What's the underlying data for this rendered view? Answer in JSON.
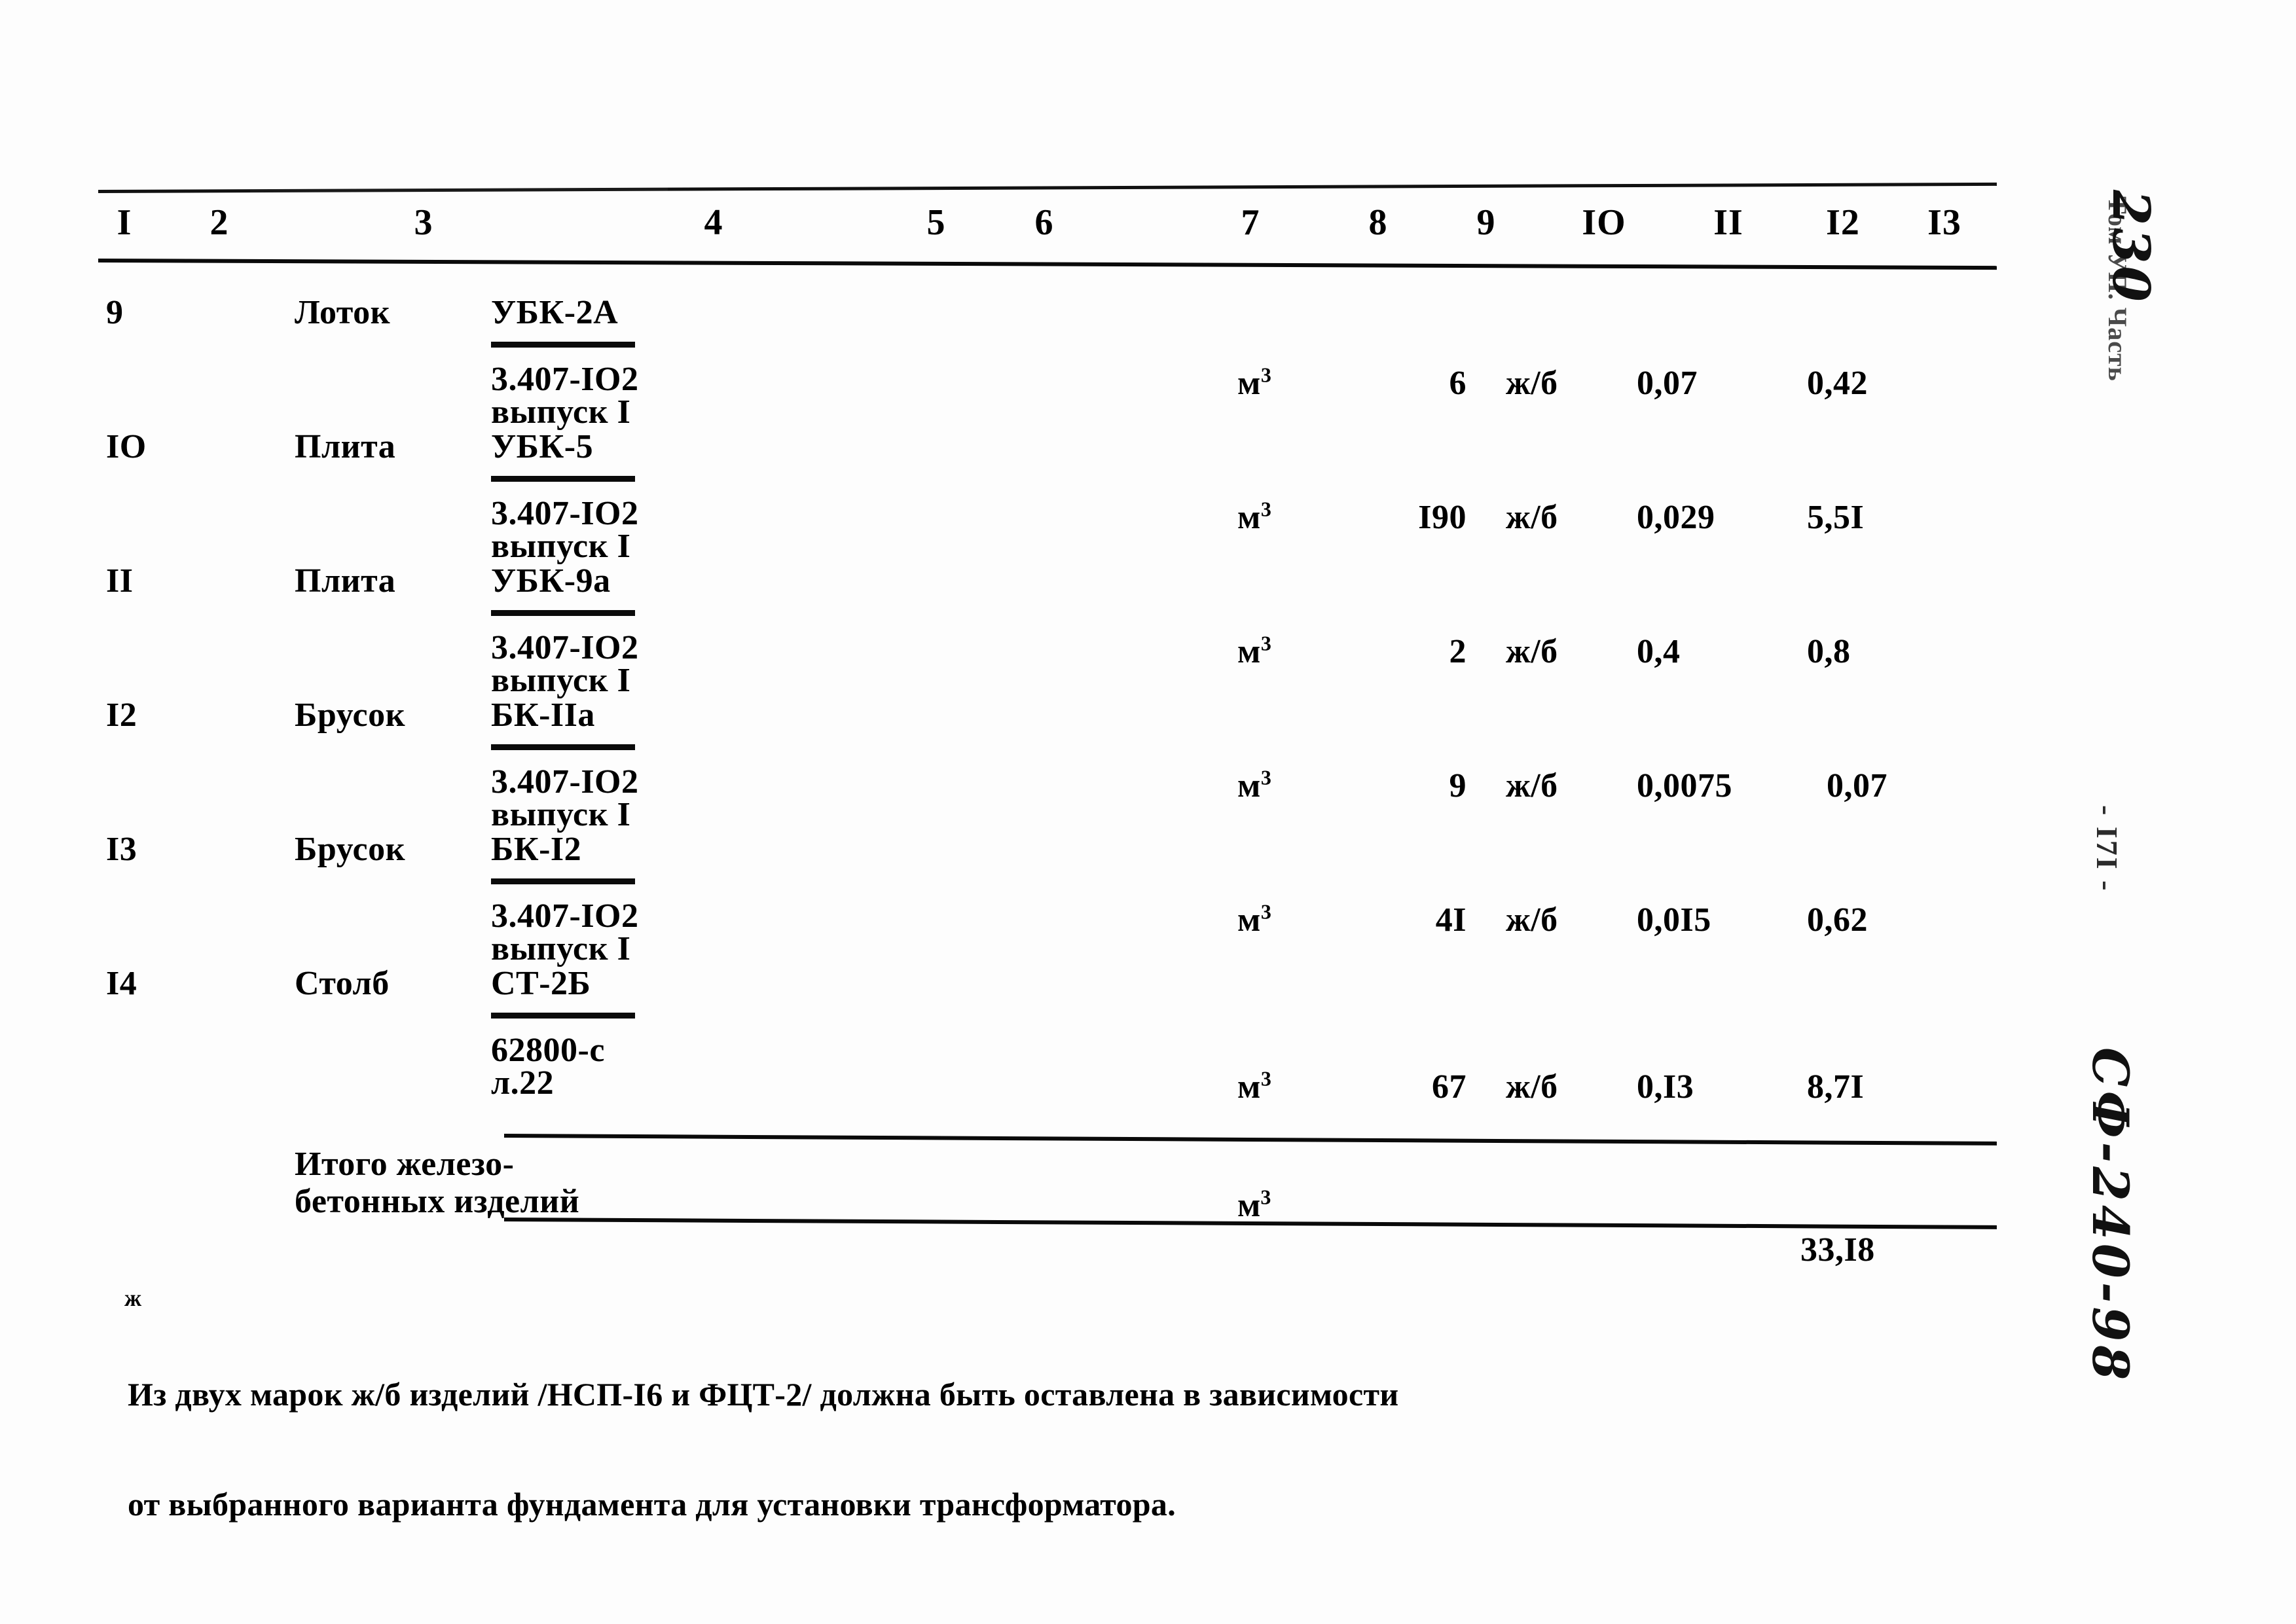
{
  "document": {
    "type": "scanned-specification-table",
    "page_label": "- I7I -",
    "margin_volume": "Том УП. Часть",
    "margin_hand_number": "230",
    "margin_archive_code": "СФ-240-98"
  },
  "table": {
    "column_headers": [
      "I",
      "2",
      "3",
      "4",
      "5",
      "6",
      "7",
      "8",
      "9",
      "IO",
      "II",
      "I2",
      "I3"
    ],
    "rows": [
      {
        "num": "9",
        "name": "Лоток",
        "mark": "УБК-2А",
        "spec_line1": "3.407-IO2",
        "spec_line2": "выпуск I",
        "unit": "м",
        "unit_sup": "3",
        "qty": "6",
        "material": "ж/б",
        "unit_weight": "0,07",
        "total_weight": "0,42"
      },
      {
        "num": "IO",
        "name": "Плита",
        "mark": "УБК-5",
        "spec_line1": "3.407-IO2",
        "spec_line2": "выпуск I",
        "unit": "м",
        "unit_sup": "3",
        "qty": "I90",
        "material": "ж/б",
        "unit_weight": "0,029",
        "total_weight": "5,5I"
      },
      {
        "num": "II",
        "name": "Плита",
        "mark": "УБК-9а",
        "spec_line1": "3.407-IO2",
        "spec_line2": "выпуск I",
        "unit": "м",
        "unit_sup": "3",
        "qty": "2",
        "material": "ж/б",
        "unit_weight": "0,4",
        "total_weight": "0,8"
      },
      {
        "num": "I2",
        "name": "Брусок",
        "mark": "БК-IIа",
        "spec_line1": "3.407-IO2",
        "spec_line2": "выпуск I",
        "unit": "м",
        "unit_sup": "3",
        "qty": "9",
        "material": "ж/б",
        "unit_weight": "0,0075",
        "total_weight": "0,07"
      },
      {
        "num": "I3",
        "name": "Брусок",
        "mark": "БК-I2",
        "spec_line1": "3.407-IO2",
        "spec_line2": "выпуск I",
        "unit": "м",
        "unit_sup": "3",
        "qty": "4I",
        "material": "ж/б",
        "unit_weight": "0,0I5",
        "total_weight": "0,62"
      },
      {
        "num": "I4",
        "name": "Столб",
        "mark": "СТ-2Б",
        "spec_line1": "62800-с",
        "spec_line2": "л.22",
        "unit": "м",
        "unit_sup": "3",
        "qty": "67",
        "material": "ж/б",
        "unit_weight": "0,I3",
        "total_weight": "8,7I"
      }
    ],
    "totals": {
      "label_line1": "Итого железо-",
      "label_line2": "бетонных изделий",
      "unit": "м",
      "unit_sup": "3",
      "value": "33,I8"
    }
  },
  "footnote": {
    "marker": "ж",
    "line1": "Из двух марок ж/б изделий /НСП-I6 и ФЦТ-2/ должна быть оставлена в зависимости",
    "line2": "от выбранного варианта фундамента для установки трансформатора."
  }
}
